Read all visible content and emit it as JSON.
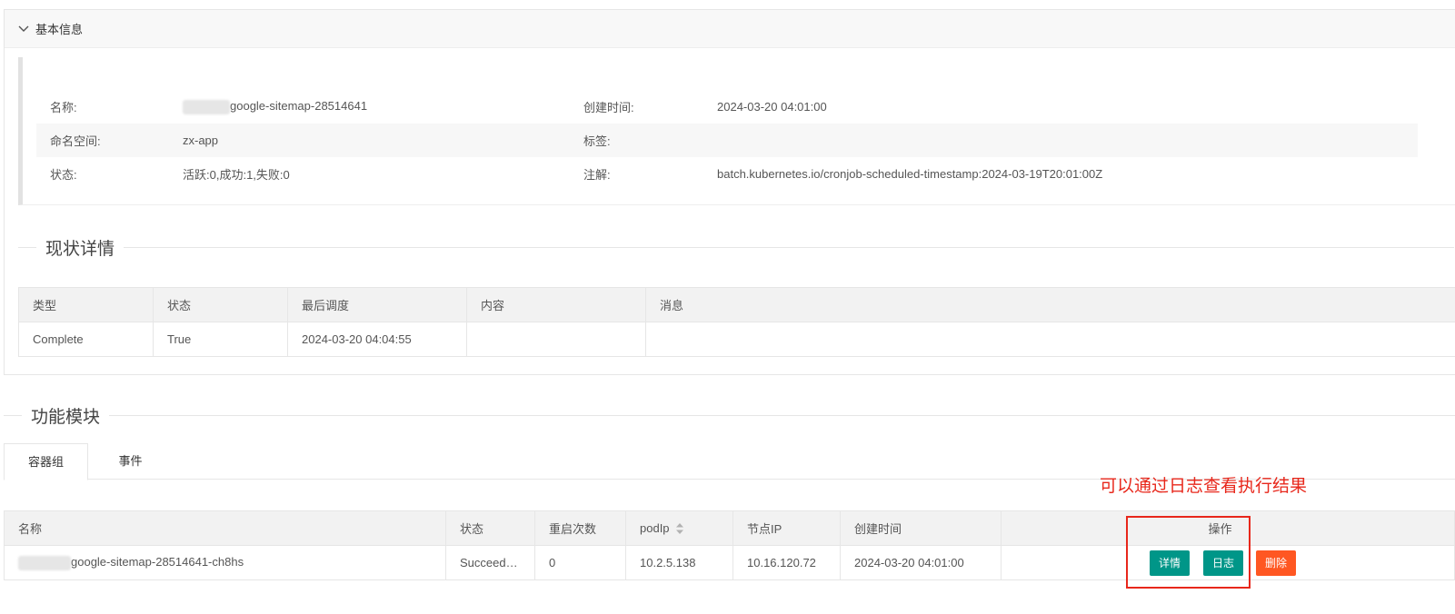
{
  "basic": {
    "title": "基本信息",
    "rows": [
      {
        "label1": "名称:",
        "value1": "google-sitemap-28514641",
        "label2": "创建时间:",
        "value2": "2024-03-20 04:01:00"
      },
      {
        "label1": "命名空间:",
        "value1": "zx-app",
        "label2": "标签:",
        "value2": ""
      },
      {
        "label1": "状态:",
        "value1": "活跃:0,成功:1,失败:0",
        "label2": "注解:",
        "value2": "batch.kubernetes.io/cronjob-scheduled-timestamp:2024-03-19T20:01:00Z"
      }
    ]
  },
  "status_section": {
    "title": "现状详情",
    "headers": [
      "类型",
      "状态",
      "最后调度",
      "内容",
      "消息"
    ],
    "rows": [
      [
        "Complete",
        "True",
        "2024-03-20 04:04:55",
        "",
        ""
      ]
    ]
  },
  "modules": {
    "title": "功能模块",
    "tabs": [
      {
        "label": "容器组",
        "active": true
      },
      {
        "label": "事件",
        "active": false
      }
    ]
  },
  "annotation": "可以通过日志查看执行结果",
  "pods": {
    "headers": [
      "名称",
      "状态",
      "重启次数",
      "podIp",
      "节点IP",
      "创建时间",
      "",
      "操作"
    ],
    "rows": [
      [
        "google-sitemap-28514641-ch8hs",
        "Succeed…",
        "0",
        "10.2.5.138",
        "10.16.120.72",
        "2024-03-20 04:01:00"
      ]
    ],
    "actions": {
      "detail": "详情",
      "log": "日志",
      "delete": "删除"
    }
  },
  "colors": {
    "teal": "#009688",
    "orange": "#ff5722",
    "annotation_red": "#e8271b"
  }
}
